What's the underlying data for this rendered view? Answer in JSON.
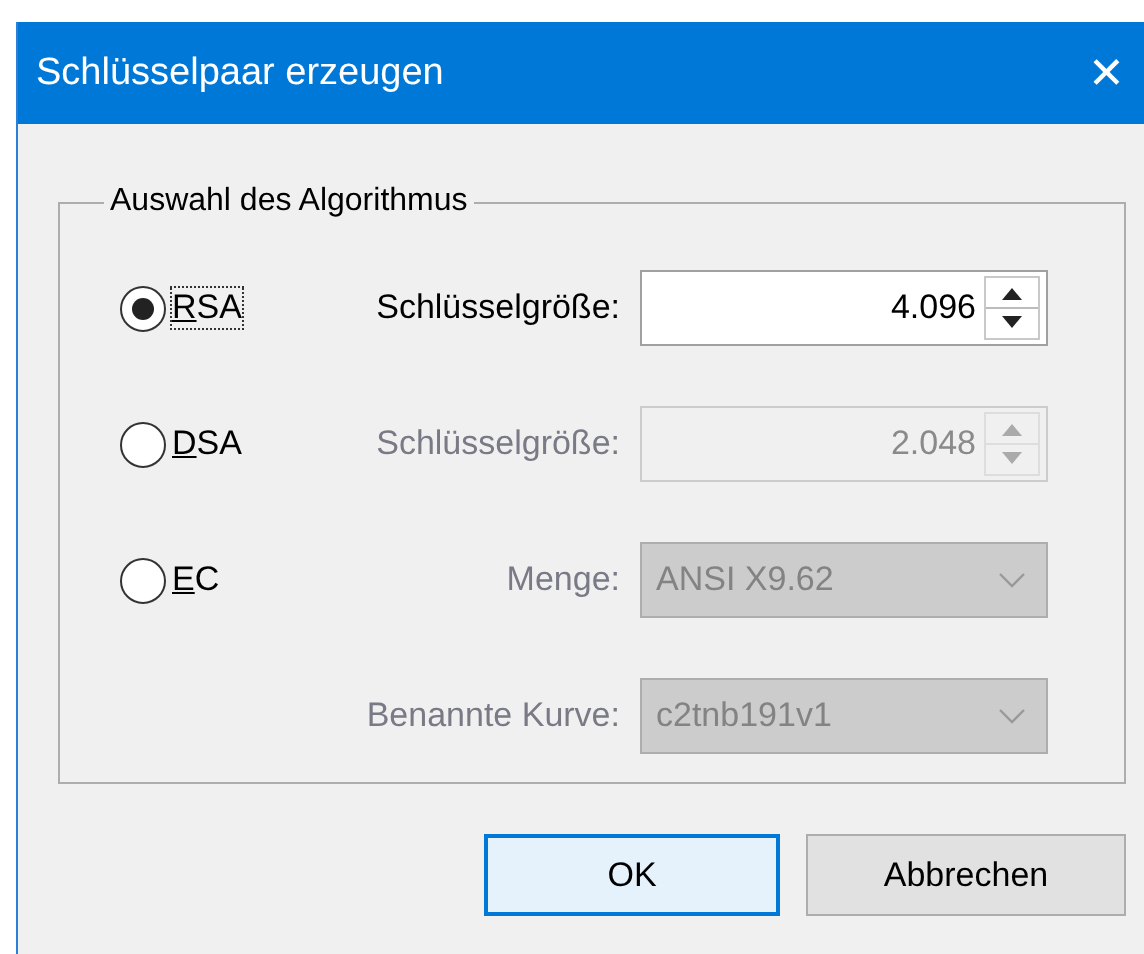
{
  "window": {
    "title": "Schlüsselpaar erzeugen",
    "close": "✕"
  },
  "group": {
    "title": "Auswahl des Algorithmus",
    "rows": [
      {
        "kind": "spinner",
        "radio": {
          "label": "RSA",
          "selected": true,
          "focused": true
        },
        "label": "Schlüsselgröße:",
        "value": "4.096",
        "disabled": false
      },
      {
        "kind": "spinner",
        "radio": {
          "label": "DSA",
          "selected": false,
          "focused": false
        },
        "label": "Schlüsselgröße:",
        "value": "2.048",
        "disabled": true
      },
      {
        "kind": "dropdown",
        "radio": {
          "label": "EC",
          "selected": false,
          "focused": false
        },
        "label": "Menge:",
        "value": "ANSI X9.62",
        "disabled": true
      },
      {
        "kind": "dropdown",
        "label": "Benannte Kurve:",
        "value": "c2tnb191v1",
        "disabled": true
      }
    ]
  },
  "buttons": [
    {
      "label": "OK",
      "default": true
    },
    {
      "label": "Abbrechen",
      "default": false
    }
  ]
}
